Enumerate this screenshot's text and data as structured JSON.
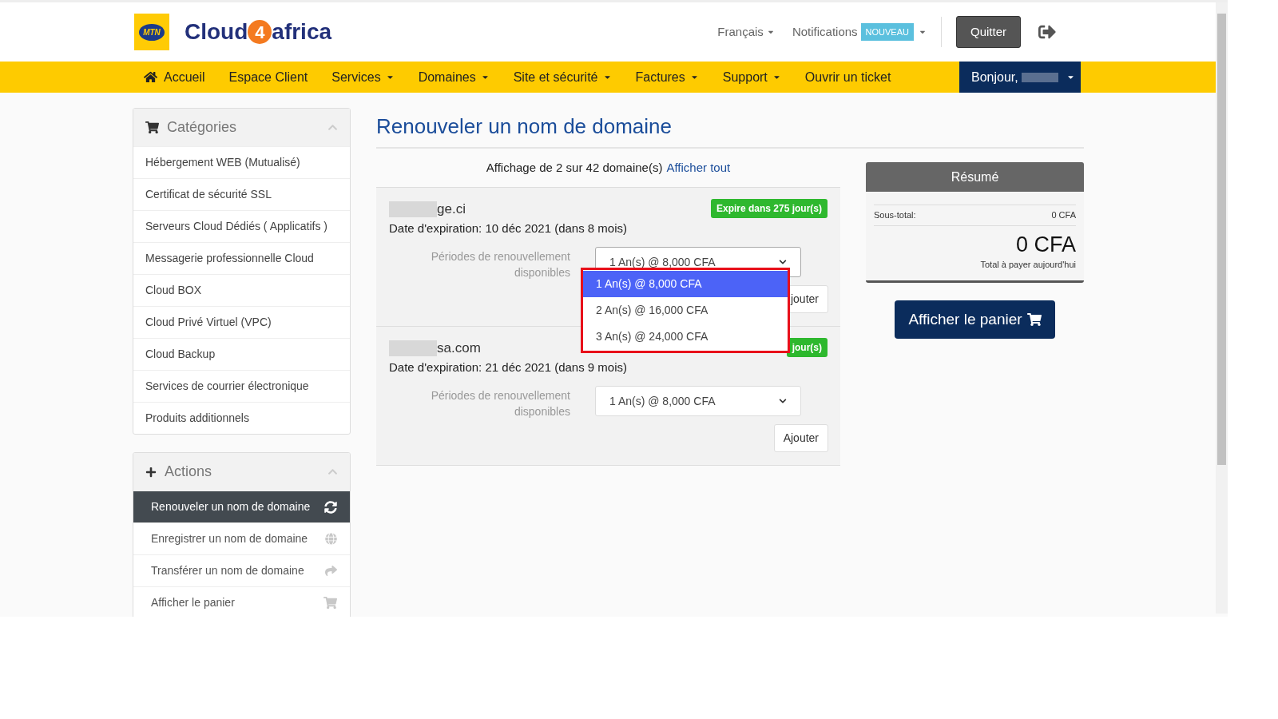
{
  "header": {
    "brand_badge": "MTN",
    "brand_parts": [
      "Cloud",
      "4",
      "africa"
    ],
    "language": "Français",
    "notifications": {
      "label": "Notifications",
      "badge": "NOUVEAU"
    },
    "logout_button": "Quitter"
  },
  "nav": {
    "items": [
      {
        "label": "Accueil",
        "dropdown": false,
        "kind": "home"
      },
      {
        "label": "Espace Client",
        "dropdown": false,
        "kind": "link"
      },
      {
        "label": "Services",
        "dropdown": true,
        "kind": "link"
      },
      {
        "label": "Domaines",
        "dropdown": true,
        "kind": "link"
      },
      {
        "label": "Site et sécurité",
        "dropdown": true,
        "kind": "link"
      },
      {
        "label": "Factures",
        "dropdown": true,
        "kind": "link"
      },
      {
        "label": "Support",
        "dropdown": true,
        "kind": "link"
      },
      {
        "label": "Ouvrir un ticket",
        "dropdown": false,
        "kind": "link"
      }
    ],
    "account": "Bonjour,"
  },
  "sidebar": {
    "categories": {
      "title": "Catégories",
      "items": [
        "Hébergement WEB (Mutualisé)",
        "Certificat de sécurité SSL",
        "Serveurs Cloud Dédiés ( Applicatifs )",
        "Messagerie professionnelle Cloud",
        "Cloud BOX",
        "Cloud Privé Virtuel (VPC)",
        "Cloud Backup",
        "Services de courrier électronique",
        "Produits additionnels"
      ]
    },
    "actions": {
      "title": "Actions",
      "items": [
        {
          "label": "Renouveler un nom de domaine",
          "kind": "refresh",
          "selected": true
        },
        {
          "label": "Enregistrer un nom de domaine",
          "kind": "globe",
          "selected": false
        },
        {
          "label": "Transférer un nom de domaine",
          "kind": "share",
          "selected": false
        },
        {
          "label": "Afficher le panier",
          "kind": "cart",
          "selected": false
        }
      ]
    }
  },
  "main": {
    "title": "Renouveler un nom de domaine",
    "summary_text": "Affichage de 2 sur 42 domaine(s)",
    "show_all_link": "Afficher tout",
    "domains": [
      {
        "name": "ge.ci",
        "expiry": "Date d'expiration: 10 déc 2021 (dans 8 mois)",
        "badge": "Expire dans 275 jour(s)",
        "period_label": "Périodes de renouvellement disponibles",
        "period_value": "1 An(s) @ 8,000 CFA",
        "add_button": "jouter",
        "open": true,
        "options": [
          {
            "label": "1 An(s) @ 8,000 CFA",
            "selected": true
          },
          {
            "label": "2 An(s) @ 16,000 CFA",
            "selected": false
          },
          {
            "label": "3 An(s) @ 24,000 CFA",
            "selected": false
          }
        ]
      },
      {
        "name": "sa.com",
        "expiry": "Date d'expiration: 21 déc 2021 (dans 9 mois)",
        "badge": "jour(s)",
        "period_label": "Périodes de renouvellement disponibles",
        "period_value": "1 An(s) @ 8,000 CFA",
        "add_button": "Ajouter",
        "open": false
      }
    ]
  },
  "order_summary": {
    "title": "Résumé",
    "subtotal_label": "Sous-total:",
    "subtotal_value": "0 CFA",
    "total": "0 CFA",
    "total_label": "Total à payer aujourd'hui",
    "cart_button": "Afficher le panier"
  }
}
